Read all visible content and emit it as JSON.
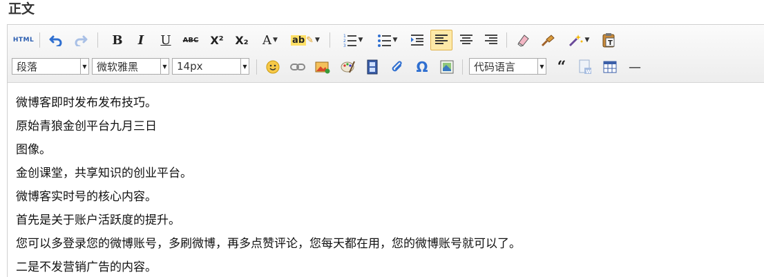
{
  "section_title": "正文",
  "toolbar": {
    "html_label": "HTML",
    "bold_label": "B",
    "italic_label": "I",
    "underline_label": "U",
    "strike_label": "ABC",
    "superscript_label": "X²",
    "subscript_label": "X₂",
    "font_color_label": "A",
    "highlight_label": "ab",
    "paragraph_select": "段落",
    "font_family_select": "微软雅黑",
    "font_size_select": "14px",
    "code_language_select": "代码语言",
    "quote_label": "66",
    "hr_label": "—"
  },
  "content": {
    "lines": [
      "微博客即时发布发布技巧。",
      "原始青狼金创平台九月三日",
      "图像。",
      "金创课堂，共享知识的创业平台。",
      "微博客实时号的核心内容。",
      "首先是关于账户活跃度的提升。",
      "您可以多登录您的微博账号，多刷微博，再多点赞评论，您每天都在用，您的微博账号就可以了。",
      "二是不发营销广告的内容。"
    ]
  },
  "colors": {
    "toolbar_bg": "#efefef",
    "active_bg": "#fde9a8",
    "icon_blue": "#2f6fd0"
  }
}
